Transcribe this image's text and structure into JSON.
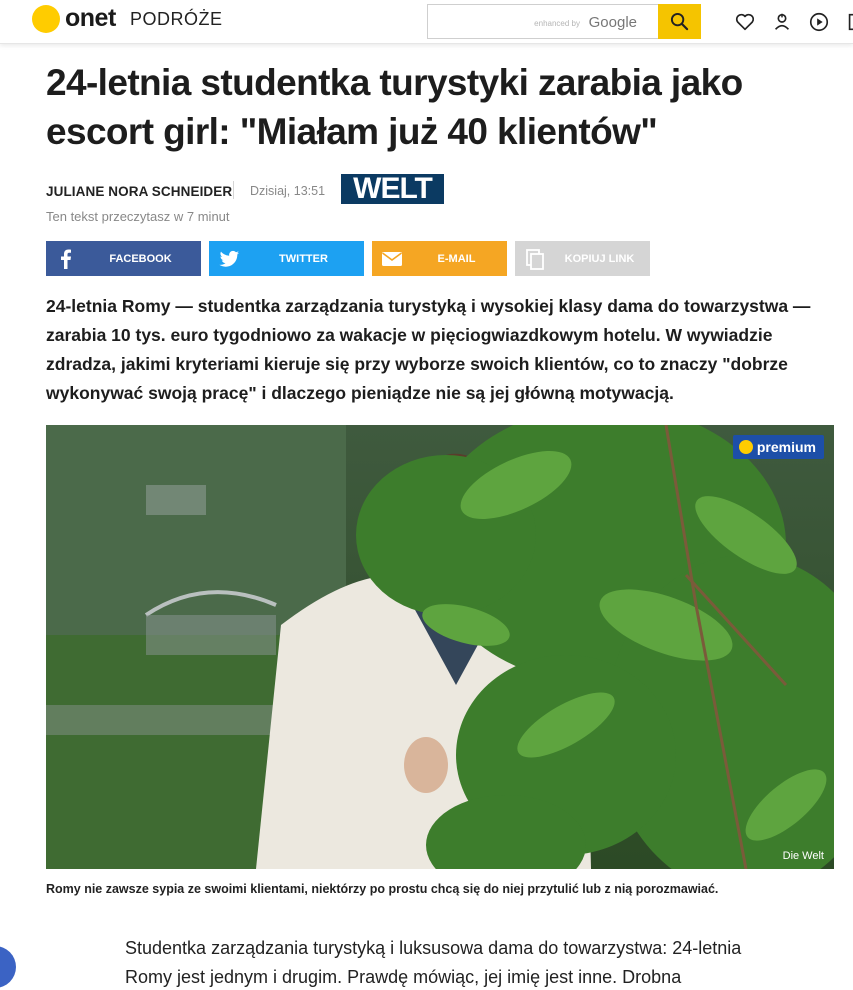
{
  "header": {
    "logo_text": "onet",
    "section": "PODRÓŻE",
    "search": {
      "enhanced_by": "enhanced by",
      "google_label": "Google"
    },
    "icons": [
      "heart-icon",
      "upload-icon",
      "play-icon",
      "bookmark-icon"
    ]
  },
  "article": {
    "headline": "24-letnia studentka turystyki zarabia jako escort girl: \"Miałam już 40 klientów\"",
    "author": "JULIANE NORA SCHNEIDER",
    "date": "Dzisiaj, 13:51",
    "source_logo": "WELT",
    "read_time": "Ten tekst przeczytasz w 7 minut",
    "lead": "24-letnia Romy — studentka zarządzania turystyką i wysokiej klasy dama do towarzystwa — zarabia 10 tys. euro tygodniowo za wakacje w pięciogwiazdkowym hotelu. W wywiadzie zdradza, jakimi kryteriami kieruje się przy wyborze swoich klientów, co to znaczy \"dobrze wykonywać swoją pracę\" i dlaczego pieniądze nie są jej główną motywacją.",
    "image": {
      "badge": "premium",
      "credit": "Die Welt",
      "caption": "Romy nie zawsze sypia ze swoimi klientami, niektórzy po prostu chcą się do niej przytulić lub z nią porozmawiać."
    },
    "body_start": "Studentka zarządzania turystyką i luksusowa dama do towarzystwa: 24-letnia Romy jest jednym i drugim. Prawdę mówiąc, jej imię jest inne. Drobna"
  },
  "share": {
    "facebook": "FACEBOOK",
    "twitter": "TWITTER",
    "email": "E-MAIL",
    "copy": "KOPIUJ LINK"
  },
  "colors": {
    "brand_yellow": "#ffcc00",
    "facebook": "#3b5a9a",
    "twitter": "#1da1f2",
    "email": "#f5a623",
    "copy": "#d5d5d5",
    "welt": "#0b3a62",
    "premium": "#1d4fa8"
  }
}
